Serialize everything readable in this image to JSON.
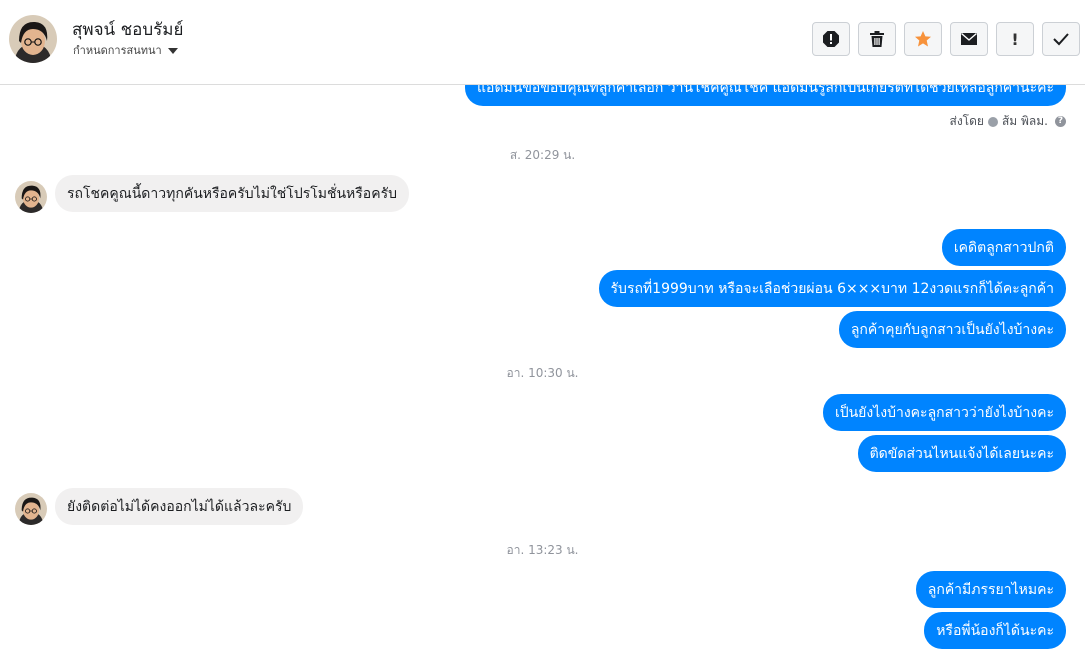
{
  "header": {
    "contact_name": "สุพจน์ ชอบรัมย์",
    "assign_label": "กำหนดการสนทนา"
  },
  "toolbar": {
    "buttons": [
      {
        "icon": "spam-report-icon"
      },
      {
        "icon": "trash-icon"
      },
      {
        "icon": "star-icon",
        "color": "#f7923b"
      },
      {
        "icon": "envelope-icon"
      },
      {
        "icon": "exclamation-icon",
        "label": "!"
      },
      {
        "icon": "checkmark-icon"
      }
    ]
  },
  "thread": {
    "top_partial_text": "แอดมินขอขอบคุณที่ลูกค้าเลือก วานโชคคูณโชค แอดมินรู้สึกเป็นเกียรติที่ได้ช่วยเหลือลูกค้านะคะ",
    "sent_by_label": "ส่งโดย",
    "sent_by_name": "ส้ม พิลม.",
    "help_mark": "?",
    "timestamps": [
      "ส. 20:29 น.",
      "อา. 10:30 น.",
      "อา. 13:23 น."
    ],
    "incoming": [
      "รถโชคคูณนี้ดาวทุกคันหรือครับไม่ใช่โปรโมชั่นหรือครับ",
      "ยังติดต่อไม่ได้คงออกไม่ได้แล้วละครับ"
    ],
    "outgoing_group1": [
      "เคดิตลูกสาวปกติ",
      "รับรถที่1999บาท หรือจะเลือช่วยผ่อน 6×××บาท 12งวดแรกก็ได้คะลูกค้า",
      "ลูกค้าคุยกับลูกสาวเป็นยังไงบ้างคะ"
    ],
    "outgoing_group2": [
      "เป็นยังไงบ้างคะลูกสาวว่ายังไงบ้างคะ",
      "ติดขัดส่วนไหนแจ้งได้เลยนะคะ"
    ],
    "outgoing_group3": [
      "ลูกค้ามีภรรยาไหมคะ",
      "หรือพี่น้องก็ได้นะคะ"
    ]
  },
  "colors": {
    "accent": "#0084ff",
    "incoming_bubble": "#f1f0f0",
    "star": "#f7923b"
  }
}
